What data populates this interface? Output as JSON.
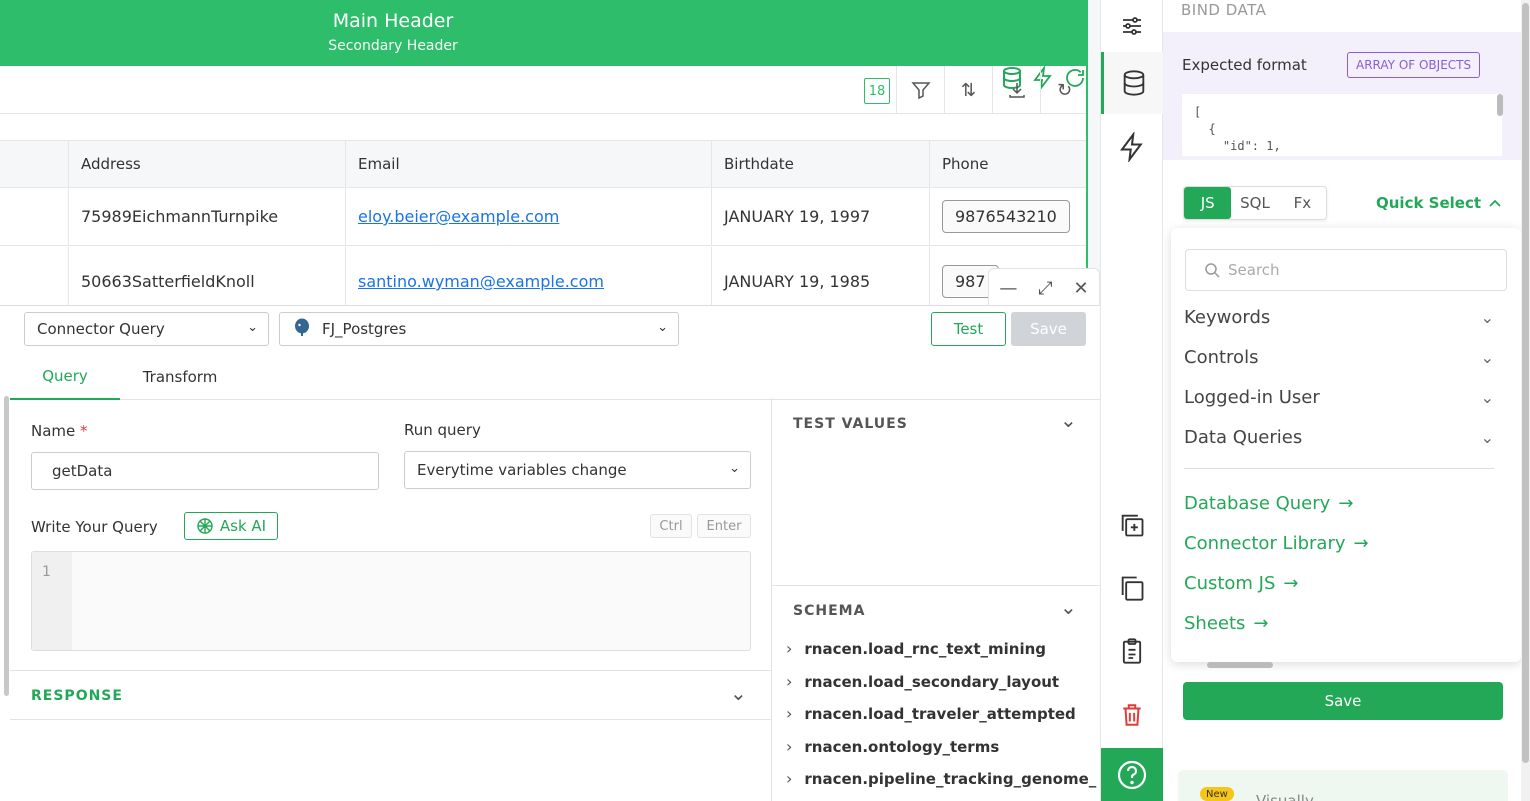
{
  "table": {
    "header_title": "Main Header",
    "header_subtitle": "Secondary Header",
    "row_count": "18",
    "columns": [
      "Address",
      "Email",
      "Birthdate",
      "Phone"
    ],
    "rows": [
      {
        "address": "75989EichmannTurnpike",
        "email": "eloy.beier@example.com",
        "birthdate": "JANUARY 19, 1997",
        "phone": "9876543210"
      },
      {
        "address": "50663SatterfieldKnoll",
        "email": "santino.wyman@example.com",
        "birthdate": "JANUARY 19, 1985",
        "phone": "987"
      }
    ]
  },
  "query": {
    "type_select": "Connector Query",
    "datasource_select": "FJ_Postgres",
    "test_label": "Test",
    "save_label": "Save",
    "tabs": [
      "Query",
      "Transform"
    ],
    "name_label": "Name",
    "required_mark": "*",
    "name_value": "getData",
    "run_label": "Run query",
    "run_value": "Everytime variables change",
    "write_label": "Write Your Query",
    "ask_ai_label": "Ask AI",
    "kbd_ctrl": "Ctrl",
    "kbd_enter": "Enter",
    "line_number": "1",
    "response_label": "RESPONSE",
    "test_values_label": "TEST VALUES",
    "schema_label": "SCHEMA",
    "schema_items": [
      "rnacen.load_rnc_text_mining",
      "rnacen.load_secondary_layout",
      "rnacen.load_traveler_attempted",
      "rnacen.ontology_terms",
      "rnacen.pipeline_tracking_genome_"
    ]
  },
  "pane": {
    "title": "BIND DATA",
    "expected_format_label": "Expected format",
    "format_badge": "ARRAY OF OBJECTS",
    "format_code": "[\n  {\n    \"id\": 1,",
    "modes": [
      "JS",
      "SQL",
      "Fx"
    ],
    "quick_select_label": "Quick Select",
    "search_placeholder": "Search",
    "categories": [
      "Keywords",
      "Controls",
      "Logged-in User",
      "Data Queries"
    ],
    "links": [
      "Database Query",
      "Connector Library",
      "Custom JS",
      "Sheets"
    ],
    "save_label": "Save",
    "new_badge": "New",
    "promo_text": "Visually ..."
  },
  "colors": {
    "brand_green": "#22a857",
    "header_green": "#2ebd6b",
    "purple": "#8b5cd6",
    "danger": "#e53935"
  }
}
